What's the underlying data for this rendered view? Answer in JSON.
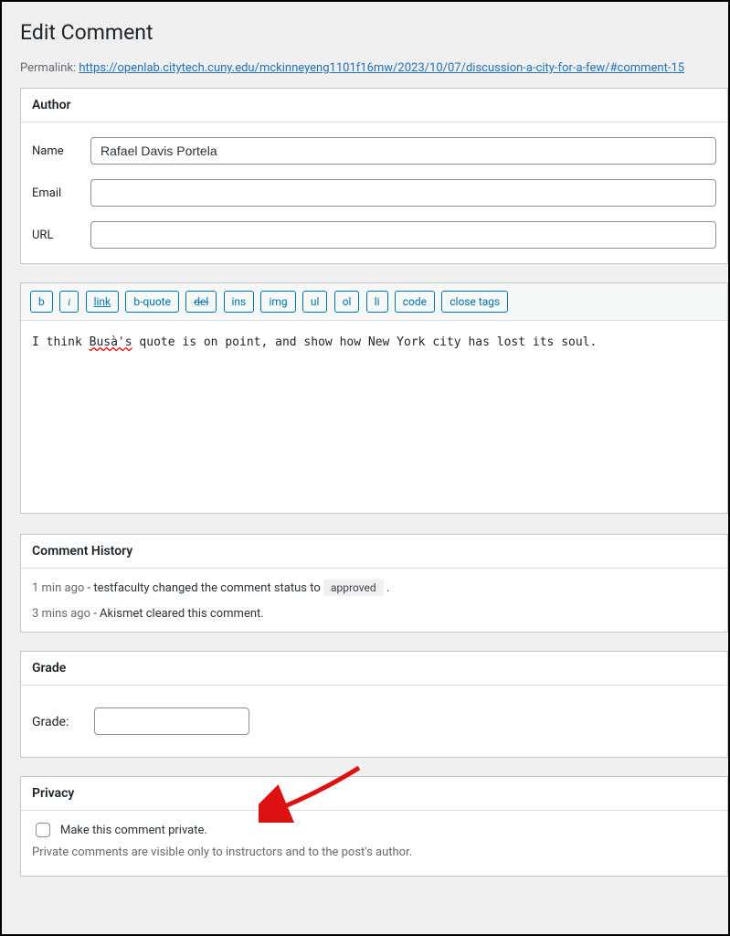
{
  "page_title": "Edit Comment",
  "permalink": {
    "label": "Permalink:",
    "url_text": "https://openlab.citytech.cuny.edu/mckinneyeng1101f16mw/2023/10/07/discussion-a-city-for-a-few/#comment-15"
  },
  "author": {
    "section_title": "Author",
    "name_label": "Name",
    "name_value": "Rafael Davis Portela",
    "email_label": "Email",
    "email_value": "",
    "url_label": "URL",
    "url_value": ""
  },
  "quicktags": {
    "b": "b",
    "i": "i",
    "link": "link",
    "bquote": "b-quote",
    "del": "del",
    "ins": "ins",
    "img": "img",
    "ul": "ul",
    "ol": "ol",
    "li": "li",
    "code": "code",
    "close": "close tags"
  },
  "editor": {
    "prefix": "I think ",
    "misspell": "Busà's",
    "suffix": " quote is on point, and show how New York city has lost its soul."
  },
  "history": {
    "section_title": "Comment History",
    "items": [
      {
        "time": "1 min ago",
        "text_before": " - testfaculty changed the comment status to ",
        "chip": "approved",
        "text_after": " ."
      },
      {
        "time": "3 mins ago",
        "text_before": " - Akismet cleared this comment.",
        "chip": "",
        "text_after": ""
      }
    ]
  },
  "grade": {
    "section_title": "Grade",
    "label": "Grade:",
    "value": ""
  },
  "privacy": {
    "section_title": "Privacy",
    "checkbox_label": "Make this comment private.",
    "help": "Private comments are visible only to instructors and to the post's author."
  }
}
